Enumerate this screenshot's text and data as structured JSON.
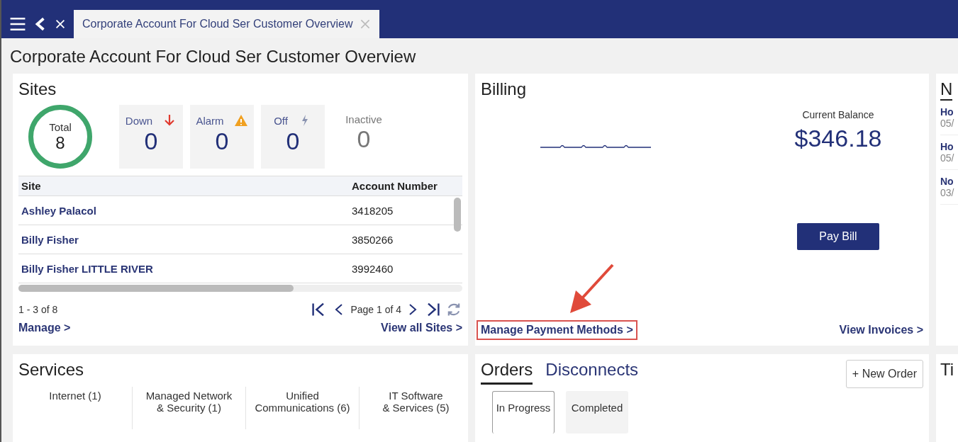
{
  "tab_bar": {
    "tabs": [
      {
        "label": "Corporate Account For Cloud Ser Customer Overview",
        "selected": true
      }
    ]
  },
  "page_title": "Corporate Account For Cloud Ser Customer Overview",
  "sites": {
    "title": "Sites",
    "stats": [
      {
        "kind": "total",
        "label": "Total",
        "value": "8"
      },
      {
        "kind": "down",
        "label": "Down",
        "value": "0"
      },
      {
        "kind": "alarm",
        "label": "Alarm",
        "value": "0"
      },
      {
        "kind": "off",
        "label": "Off",
        "value": "0"
      },
      {
        "kind": "inactive",
        "label": "Inactive",
        "value": "0"
      }
    ],
    "columns": [
      "Site",
      "Account Number"
    ],
    "rows": [
      [
        "Ashley Palacol",
        "3418205"
      ],
      [
        "Billy Fisher",
        "3850266"
      ],
      [
        "Billy Fisher LITTLE RIVER",
        "3992460"
      ]
    ],
    "range": "1 - 3 of 8",
    "page": "Page 1 of 4",
    "manage_link": "Manage >",
    "view_all_link": "View all Sites >"
  },
  "billing": {
    "title": "Billing",
    "balance_label": "Current Balance",
    "balance": "$346.18",
    "pay_button": "Pay Bill",
    "manage_payment_link": {
      "label": "Manage Payment Methods >",
      "annotated": true
    },
    "invoices_link": "View Invoices >"
  },
  "right_panel": {
    "title": "N",
    "items": [
      {
        "title": "Ho",
        "date": "05/"
      },
      {
        "title": "Ho",
        "date": "05/"
      },
      {
        "title": "No",
        "date": "03/"
      }
    ]
  },
  "services": {
    "title": "Services",
    "items": [
      "Internet (1)",
      "Managed Network\n& Security (1)",
      "Unified\nCommunications (6)",
      "IT Software\n& Services (5)"
    ]
  },
  "orders": {
    "tabs": [
      {
        "label": "Orders",
        "selected": true
      },
      {
        "label": "Disconnects",
        "selected": false
      }
    ],
    "new_order_button": "+ New Order",
    "statuses": [
      {
        "label": "In Progress",
        "selected": true
      },
      {
        "label": "Completed",
        "selected": false
      }
    ]
  },
  "bottom_right_panel": {
    "title": "Ti"
  }
}
